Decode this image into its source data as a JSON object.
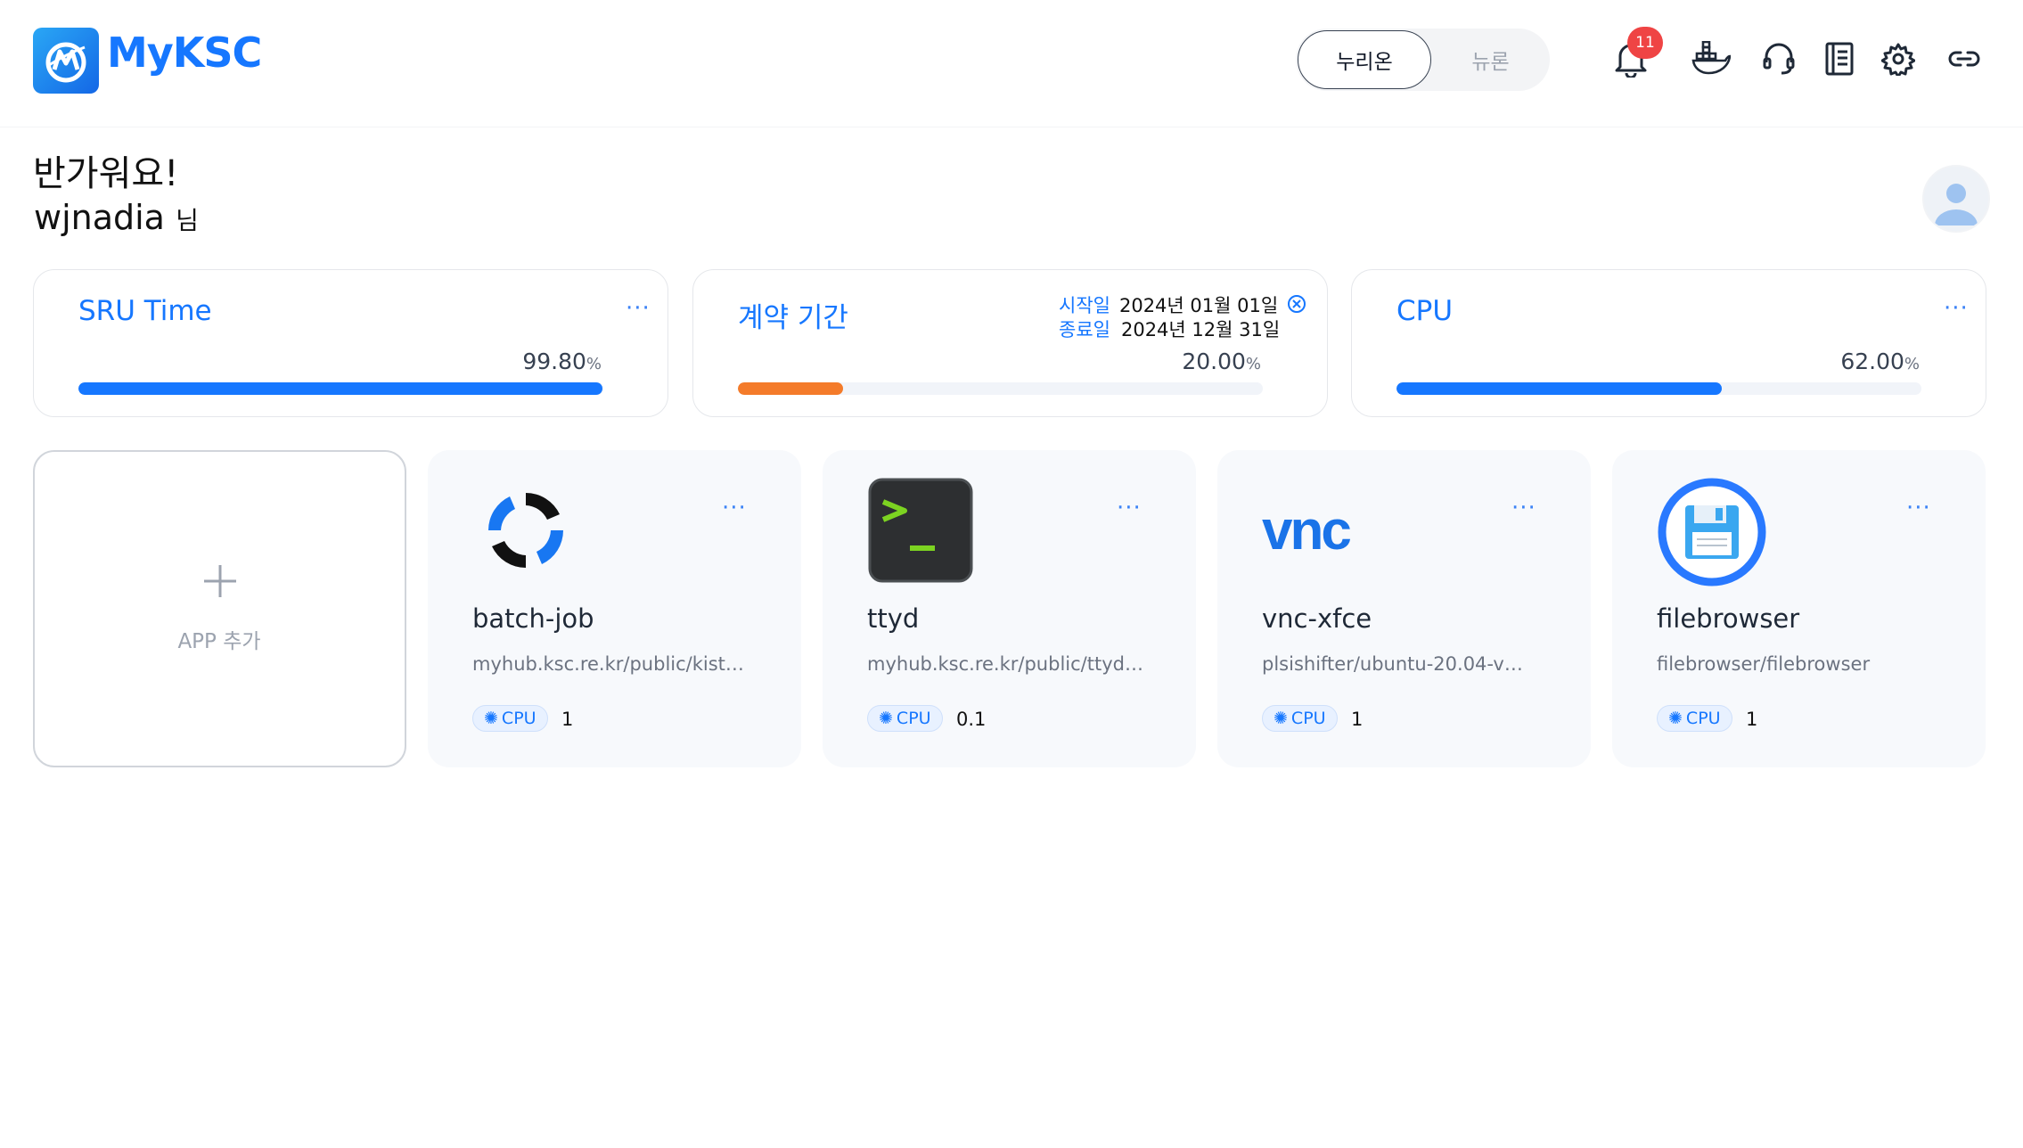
{
  "header": {
    "logo_text": "MyKSC",
    "toggle": {
      "active": "누리온",
      "inactive": "뉴론"
    },
    "notifications_count": "11",
    "icons": [
      "bell-icon",
      "docker-icon",
      "headset-icon",
      "notebook-icon",
      "gear-icon",
      "link-icon"
    ]
  },
  "greeting": {
    "line1": "반가워요!",
    "username": "wjnadia",
    "suffix": "님"
  },
  "stats": {
    "sru": {
      "title": "SRU Time",
      "value": "99.80",
      "unit": "%",
      "progress": 0.998,
      "color": "#1677ff"
    },
    "period": {
      "title": "계약 기간",
      "start_label": "시작일",
      "start": "2024년 01월 01일",
      "end_label": "종료일",
      "end": "2024년 12월 31일",
      "value": "20.00",
      "unit": "%",
      "progress": 0.2,
      "color": "#f47b2a"
    },
    "cpu": {
      "title": "CPU",
      "value": "62.00",
      "unit": "%",
      "progress": 0.62,
      "color": "#1677ff"
    },
    "more": "···"
  },
  "add_app": {
    "label": "APP 추가"
  },
  "apps": [
    {
      "name": "batch-job",
      "image": "myhub.ksc.re.kr/public/kisti…",
      "cpu_label": "CPU",
      "cpu": "1",
      "more": "···"
    },
    {
      "name": "ttyd",
      "image": "myhub.ksc.re.kr/public/ttyd…",
      "cpu_label": "CPU",
      "cpu": "0.1",
      "more": "···"
    },
    {
      "name": "vnc-xfce",
      "image": "plsishifter/ubuntu-20.04-v…",
      "cpu_label": "CPU",
      "cpu": "1",
      "more": "···",
      "logo_text": "vnc"
    },
    {
      "name": "filebrowser",
      "image": "filebrowser/filebrowser",
      "cpu_label": "CPU",
      "cpu": "1",
      "more": "···"
    }
  ]
}
